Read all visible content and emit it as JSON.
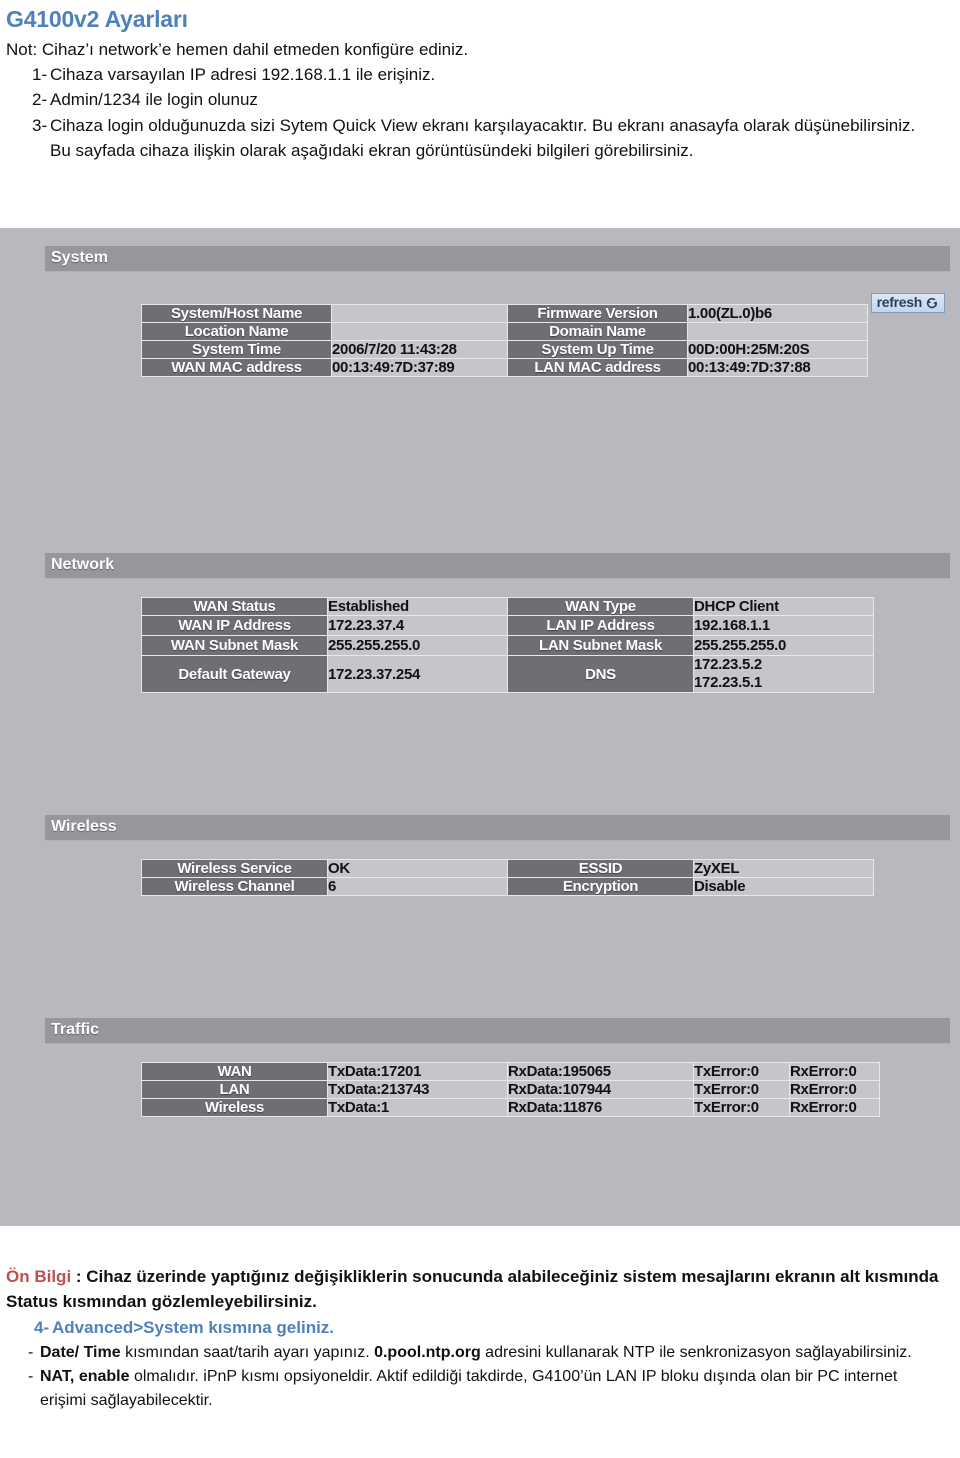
{
  "document": {
    "title": "G4100v2 Ayarları",
    "note": "Not: Cihaz’ı network’e hemen dahil etmeden konfigüre ediniz.",
    "steps": [
      {
        "num": "1-",
        "text": "Cihaza varsayılan IP adresi 192.168.1.1 ile erişiniz."
      },
      {
        "num": "2-",
        "text": "Admin/1234 ile login olunuz"
      },
      {
        "num": "3-",
        "text": "Cihaza login olduğunuzda sizi Sytem Quick View ekranı karşılayacaktır. Bu ekranı anasayfa olarak düşünebilirsiniz. Bu sayfada cihaza ilişkin olarak aşağıdaki ekran görüntüsündeki bilgileri görebilirsiniz."
      }
    ],
    "footer": {
      "on_bilgi_label": "Ön Bilgi",
      "on_bilgi_text": " : Cihaz üzerinde yaptığınız değişikliklerin sonucunda alabileceğiniz sistem mesajlarını ekranın alt kısmında Status kısmından gözlemleyebilirsiniz.",
      "step4_num": "4-",
      "step4_text": "Advanced>System kısmına geliniz.",
      "bullets": [
        {
          "dash": "-",
          "bold1": "Date/ Time",
          "text1": " kısmından saat/tarih ayarı yapınız. ",
          "bold2": "0.pool.ntp.org",
          "text2": " adresini kullanarak NTP ile senkronizasyon sağlayabilirsiniz."
        },
        {
          "dash": "-",
          "bold1": "NAT,  enable",
          "text1": " olmalıdır. iPnP kısmı opsiyoneldir. Aktif edildiği takdirde, G4100’ün LAN IP bloku dışında olan bir PC internet erişimi sağlayabilecektir.",
          "bold2": "",
          "text2": ""
        }
      ]
    },
    "colors": {
      "title_blue": "#4F81BD",
      "accent_red": "#C0504D",
      "label_grey": "#6E6E74",
      "value_grey": "#C6C6CA",
      "band_grey": "#96969C",
      "page_grey": "#B9B9BD"
    }
  },
  "screenshot": {
    "refresh_button": "refresh",
    "sections": {
      "system": {
        "title": "System",
        "rows": [
          {
            "l1": "System/Host Name",
            "v1": "",
            "l2": "Firmware Version",
            "v2": "1.00(ZL.0)b6"
          },
          {
            "l1": "Location Name",
            "v1": "",
            "l2": "Domain Name",
            "v2": ""
          },
          {
            "l1": "System Time",
            "v1": "2006/7/20 11:43:28",
            "l2": "System Up Time",
            "v2": "00D:00H:25M:20S"
          },
          {
            "l1": "WAN MAC address",
            "v1": "00:13:49:7D:37:89",
            "l2": "LAN MAC address",
            "v2": "00:13:49:7D:37:88"
          }
        ]
      },
      "network": {
        "title": "Network",
        "rows": [
          {
            "l1": "WAN Status",
            "v1": "Established",
            "l2": "WAN Type",
            "v2": "DHCP Client"
          },
          {
            "l1": "WAN IP Address",
            "v1": "172.23.37.4",
            "l2": "LAN IP Address",
            "v2": "192.168.1.1"
          },
          {
            "l1": "WAN Subnet Mask",
            "v1": "255.255.255.0",
            "l2": "LAN Subnet Mask",
            "v2": "255.255.255.0"
          },
          {
            "l1": "Default Gateway",
            "v1": "172.23.37.254",
            "l2": "DNS",
            "v2": "172.23.5.2\n172.23.5.1"
          }
        ]
      },
      "wireless": {
        "title": "Wireless",
        "rows": [
          {
            "l1": "Wireless Service",
            "v1": "OK",
            "l2": "ESSID",
            "v2": "ZyXEL"
          },
          {
            "l1": "Wireless Channel",
            "v1": "6",
            "l2": "Encryption",
            "v2": "Disable"
          }
        ]
      },
      "traffic": {
        "title": "Traffic",
        "rows": [
          {
            "iface": "WAN",
            "tx": "TxData:17201",
            "rx": "RxData:195065",
            "txe": "TxError:0",
            "rxe": "RxError:0"
          },
          {
            "iface": "LAN",
            "tx": "TxData:213743",
            "rx": "RxData:107944",
            "txe": "TxError:0",
            "rxe": "RxError:0"
          },
          {
            "iface": "Wireless",
            "tx": "TxData:1",
            "rx": "RxData:11876",
            "txe": "TxError:0",
            "rxe": "RxError:0"
          }
        ]
      }
    }
  }
}
